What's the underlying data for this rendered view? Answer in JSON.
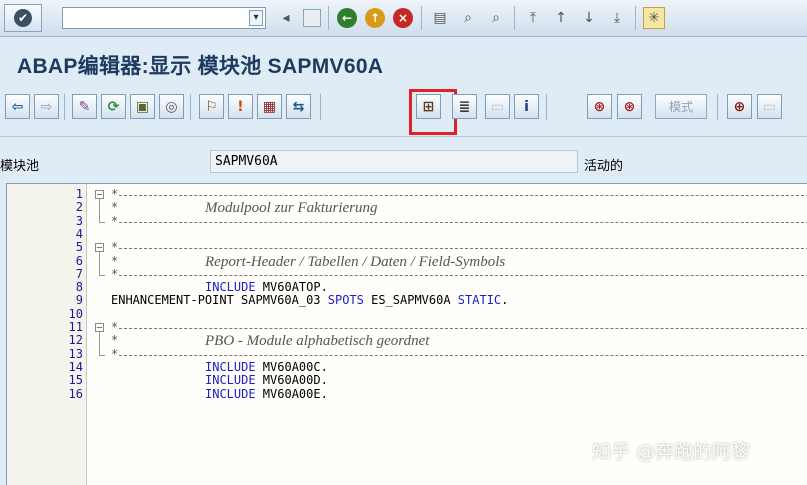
{
  "title": {
    "text": "ABAP编辑器:显示 模块池 SAPMV60A"
  },
  "field": {
    "label": "模块池",
    "value": "SAPMV60A",
    "status": "活动的"
  },
  "toolbar": {
    "mode_label": "模式"
  },
  "editor": {
    "lines": [
      {
        "n": "1",
        "type": "dash"
      },
      {
        "n": "2",
        "type": "comment",
        "text": "Modulpool zur Fakturierung"
      },
      {
        "n": "3",
        "type": "dash"
      },
      {
        "n": "4",
        "type": "blank"
      },
      {
        "n": "5",
        "type": "dash"
      },
      {
        "n": "6",
        "type": "comment",
        "text": "Report-Header / Tabellen / Daten / Field-Symbols"
      },
      {
        "n": "7",
        "type": "dash"
      },
      {
        "n": "8",
        "type": "code",
        "text": "INCLUDE MV60ATOP."
      },
      {
        "n": "9",
        "type": "code",
        "text": "ENHANCEMENT-POINT SAPMV60A_03 SPOTS ES_SAPMV60A STATIC."
      },
      {
        "n": "10",
        "type": "blank"
      },
      {
        "n": "11",
        "type": "dash"
      },
      {
        "n": "12",
        "type": "comment",
        "text": "PBO - Module alphabetisch geordnet"
      },
      {
        "n": "13",
        "type": "dash"
      },
      {
        "n": "14",
        "type": "code",
        "text": "INCLUDE MV60A00C."
      },
      {
        "n": "15",
        "type": "code",
        "text": "INCLUDE MV60A00D."
      },
      {
        "n": "16",
        "type": "code",
        "text": "INCLUDE MV60A00E."
      }
    ]
  },
  "watermark": {
    "text": "知乎 @奔跑的阿黎"
  }
}
